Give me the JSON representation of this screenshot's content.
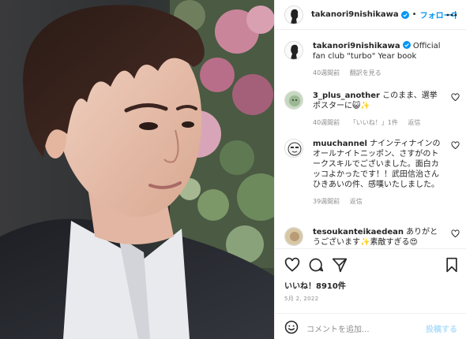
{
  "header": {
    "username": "takanori9nishikawa",
    "separator": "•",
    "follow_label": "フォロー中"
  },
  "caption": {
    "username": "takanori9nishikawa",
    "text": " Official fan club \"turbo\" Year book",
    "time": "40週間前",
    "translate": "翻訳を見る"
  },
  "comments": [
    {
      "username": "3_plus_another",
      "text": " このまま、選挙ポスターに😺✨",
      "time": "40週間前",
      "likes": "「いいね！」1件",
      "reply": "返信"
    },
    {
      "username": "muuchannel",
      "text": " ナインティナインのオールナイトニッポン、さすがのトークスキルでございました。面白カッコよかったです！！武田信治さんひきあいの件、感嘆いたしました。",
      "time": "39週間前",
      "reply": "返信"
    },
    {
      "username": "tesoukanteikaedean",
      "text": " ありがとうございます✨素敵すぎる😍"
    }
  ],
  "likes": {
    "label": "いいね！8910件"
  },
  "date": "5月 2, 2022",
  "add_comment": {
    "placeholder": "コメントを追加...",
    "post_label": "投稿する"
  },
  "icons": {
    "more": "more-horizontal-icon",
    "heart": "heart-icon",
    "comment": "comment-icon",
    "share": "share-icon",
    "bookmark": "bookmark-icon",
    "emoji": "emoji-icon",
    "verified": "verified-badge-icon"
  },
  "colors": {
    "accent": "#0095f6",
    "muted": "#8e8e8e",
    "border": "#efefef",
    "post_disabled": "#b2dffc"
  }
}
